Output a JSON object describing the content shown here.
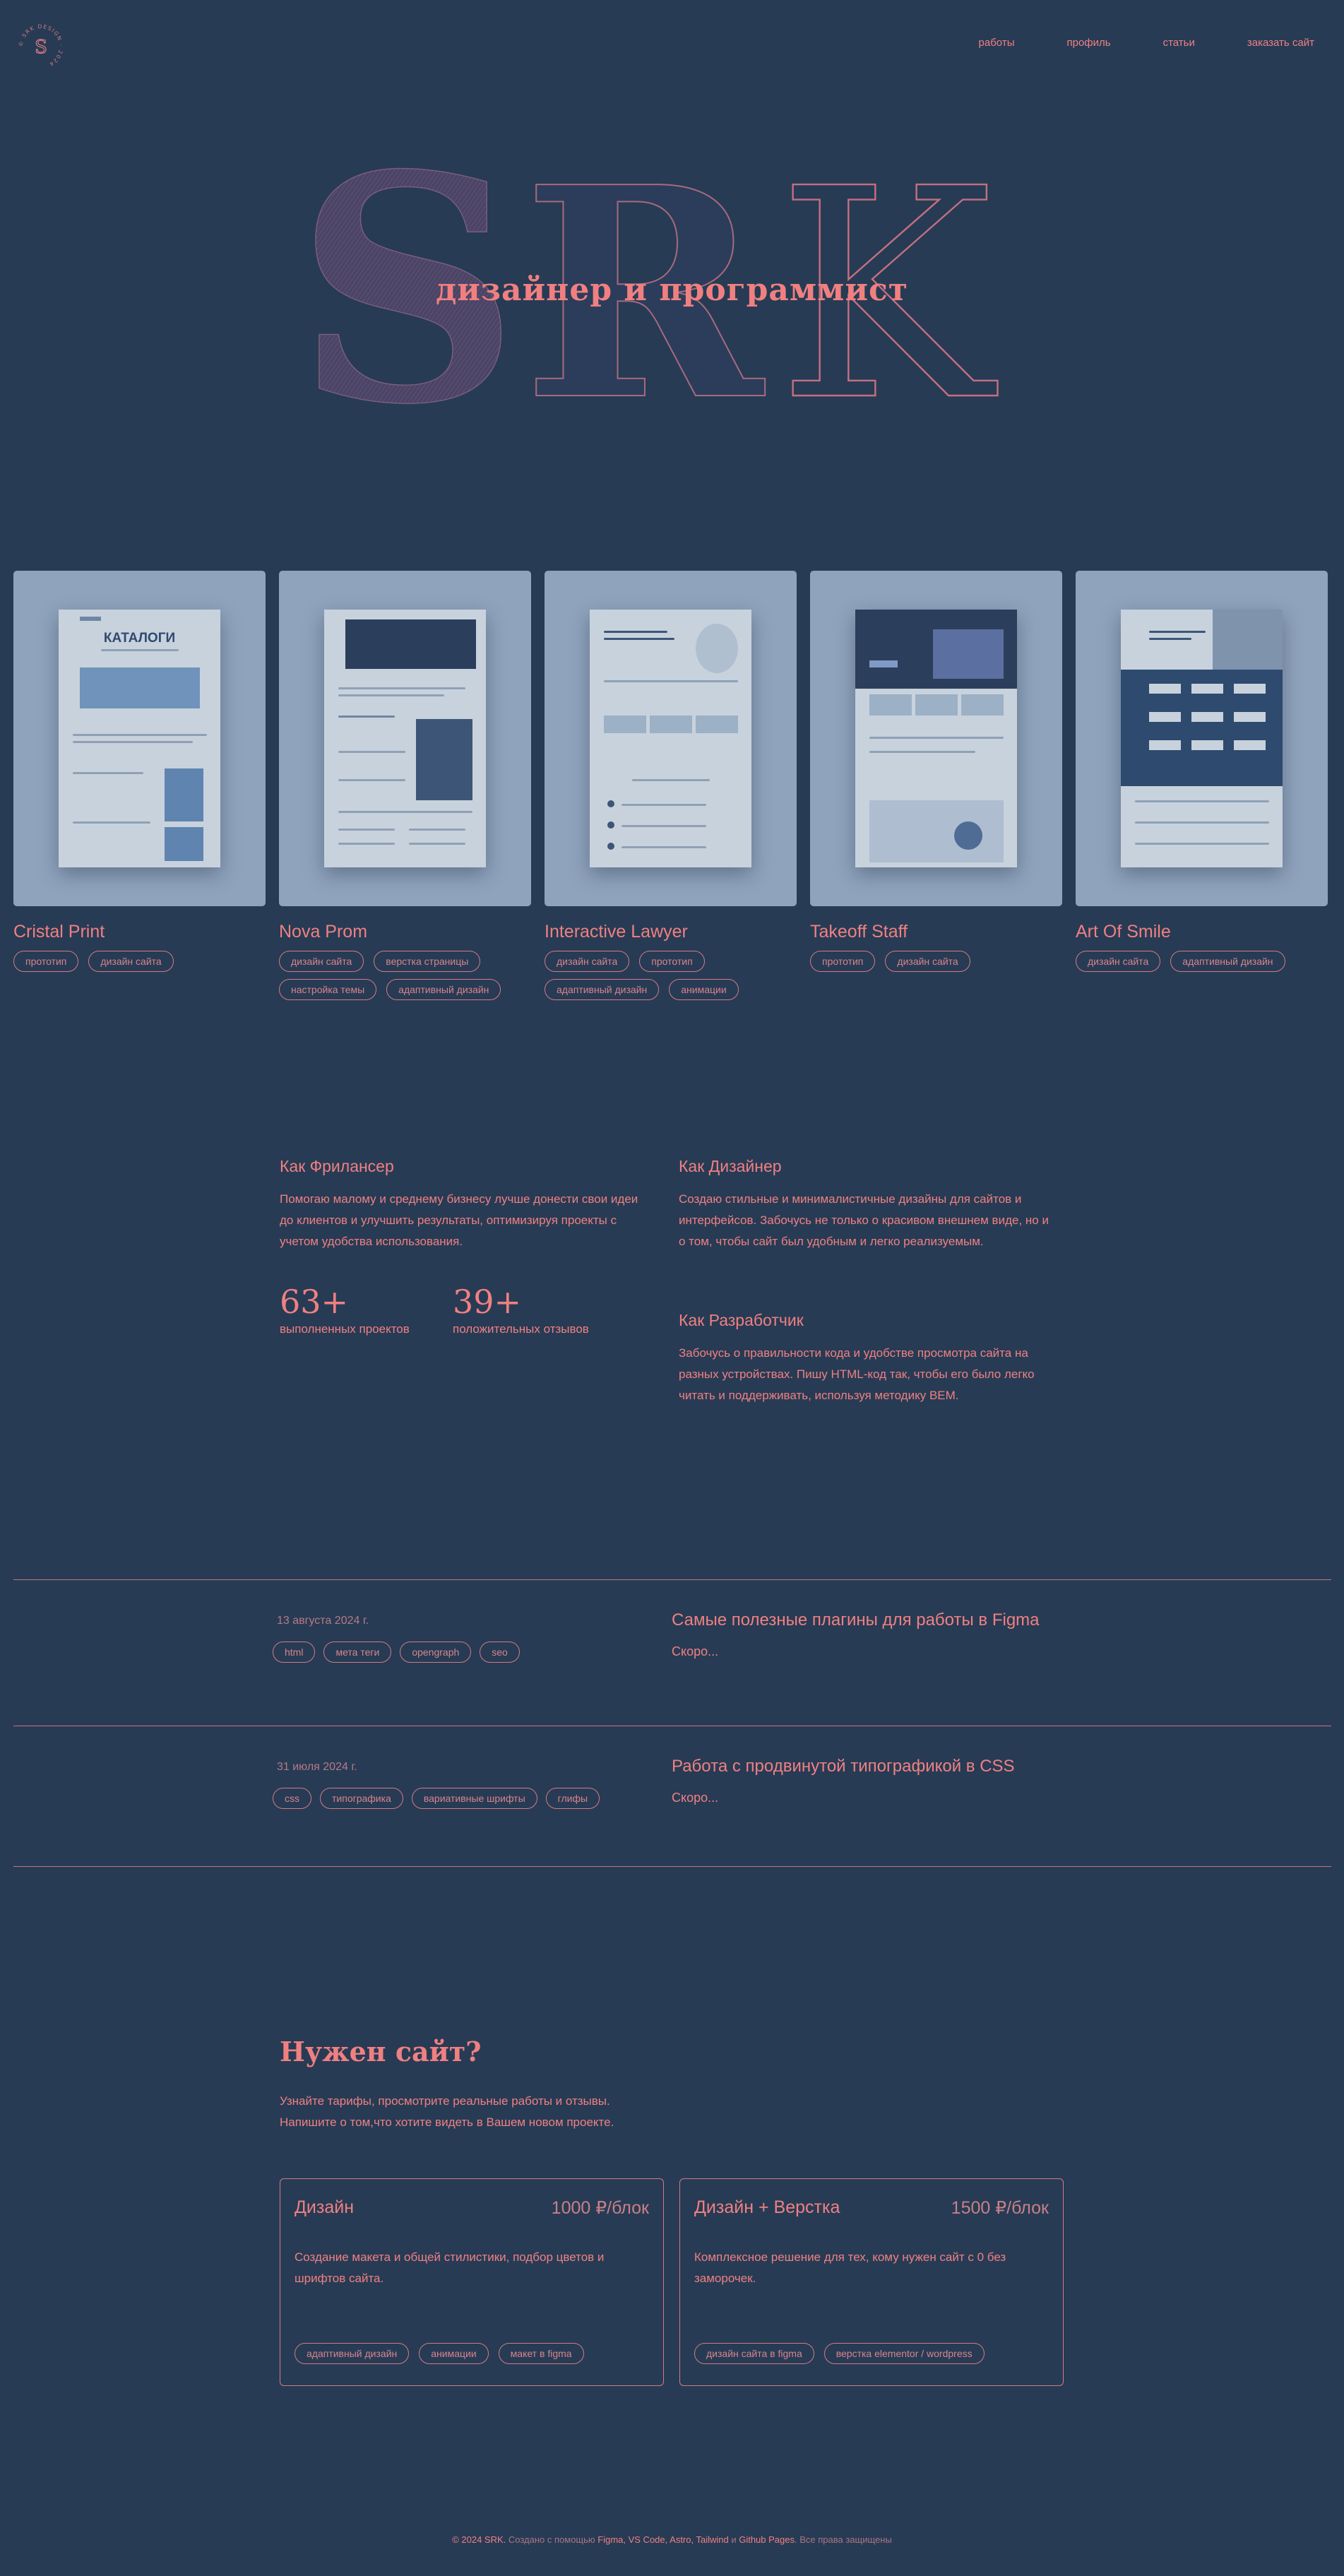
{
  "header": {
    "logo_text": "© SRK DESIGN · 2024",
    "nav": [
      "работы",
      "профиль",
      "статьи",
      "заказать сайт"
    ]
  },
  "hero": {
    "letters": "SRK",
    "tagline": "дизайнер и программист"
  },
  "projects": [
    {
      "title": "Cristal Print",
      "tags": [
        "прототип",
        "дизайн сайта"
      ],
      "thumb_heading": "КАТАЛОГИ"
    },
    {
      "title": "Nova Prom",
      "tags": [
        "дизайн сайта",
        "верстка страницы",
        "настройка темы",
        "адаптивный дизайн"
      ],
      "thumb_heading": ""
    },
    {
      "title": "Interactive Lawyer",
      "tags": [
        "дизайн сайта",
        "прототип",
        "адаптивный дизайн",
        "анимации"
      ],
      "thumb_heading": ""
    },
    {
      "title": "Takeoff Staff",
      "tags": [
        "прототип",
        "дизайн сайта"
      ],
      "thumb_heading": ""
    },
    {
      "title": "Art Of Smile",
      "tags": [
        "дизайн сайта",
        "адаптивный дизайн"
      ],
      "thumb_heading": ""
    }
  ],
  "about": {
    "freelancer": {
      "title": "Как Фрилансер",
      "text": "Помогаю малому и среднему бизнесу лучше донести свои идеи до клиентов и улучшить результаты, оптимизируя проекты с учетом удобства использования."
    },
    "designer": {
      "title": "Как Дизайнер",
      "text": "Создаю стильные и минималистичные дизайны для сайтов и интерфейсов. Забочусь не только о красивом внешнем виде, но и о том, чтобы сайт был удобным и легко реализуемым."
    },
    "developer": {
      "title": "Как Разработчик",
      "text": "Забочусь о правильности кода и удобстве просмотра сайта на разных устройствах. Пишу HTML-код так, чтобы его было легко читать и поддерживать, используя методику BEM."
    },
    "stats": [
      {
        "value": "63+",
        "label": "выполненных проектов"
      },
      {
        "value": "39+",
        "label": "положительных отзывов"
      }
    ]
  },
  "articles": [
    {
      "date": "13 августа 2024 г.",
      "tags": [
        "html",
        "мета теги",
        "opengraph",
        "seo"
      ],
      "title": "Самые полезные плагины для работы в Figma",
      "excerpt": "Скоро..."
    },
    {
      "date": "31 июля 2024 г.",
      "tags": [
        "css",
        "типографика",
        "вариативные шрифты",
        "глифы"
      ],
      "title": "Работа с продвинутой типографикой в CSS",
      "excerpt": "Скоро..."
    }
  ],
  "cta": {
    "title": "Нужен сайт?",
    "line1": "Узнайте тарифы, просмотрите реальные работы и отзывы.",
    "line2": "Напишите о том,что хотите видеть в Вашем новом проекте."
  },
  "pricing": [
    {
      "title": "Дизайн",
      "price": "1000 ₽/блок",
      "text": "Создание макета и общей стилистики, подбор цветов и шрифтов сайта.",
      "tags": [
        "адаптивный дизайн",
        "анимации",
        "макет в figma"
      ]
    },
    {
      "title": "Дизайн + Верстка",
      "price": "1500 ₽/блок",
      "text": "Комплексное решение для тех, кому нужен сайт с 0 без заморочек.",
      "tags": [
        "дизайн сайта в figma",
        "верстка elementor / wordpress"
      ]
    }
  ],
  "footer": {
    "owner": "© 2024 SRK.",
    "made_with": " Создано с помощью ",
    "tools": "Figma, VS Code, Astro, Tailwind",
    "and": " и ",
    "host": "Github Pages",
    "rights": ". Все права защищены"
  },
  "colors": {
    "background": "#273b55",
    "accent": "#f08080",
    "hero_fill": "#5c4a6c",
    "card": "#8fa3bd"
  }
}
